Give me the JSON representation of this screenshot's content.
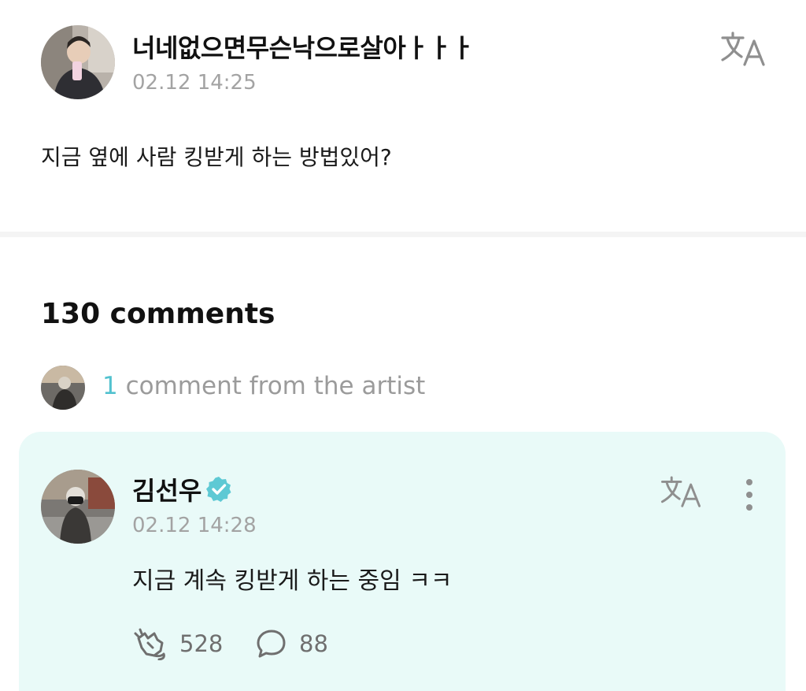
{
  "post": {
    "author": "너네없으면무슨낙으로살아ㅏㅏㅏ",
    "timestamp": "02.12 14:25",
    "body": "지금 옆에 사람 킹받게 하는 방법있어?",
    "avatar_icon": "profile-photo"
  },
  "comments": {
    "count_label": "130 comments",
    "artist_summary": {
      "count": "1",
      "text": " comment from the artist"
    }
  },
  "artist_comment": {
    "author": "김선우",
    "verified": true,
    "timestamp": "02.12 14:28",
    "body": "지금 계속 킹받게 하는 중임 ㅋㅋ",
    "likes": "528",
    "replies": "88"
  },
  "colors": {
    "accent": "#52c2cf",
    "card_background": "#e9faf8",
    "muted_text": "#a3a3a3"
  },
  "icons": {
    "translate": "translate-icon",
    "more": "more-vertical-icon",
    "like": "cheer-hand-icon",
    "reply": "speech-bubble-icon",
    "verified": "verified-badge-icon"
  }
}
